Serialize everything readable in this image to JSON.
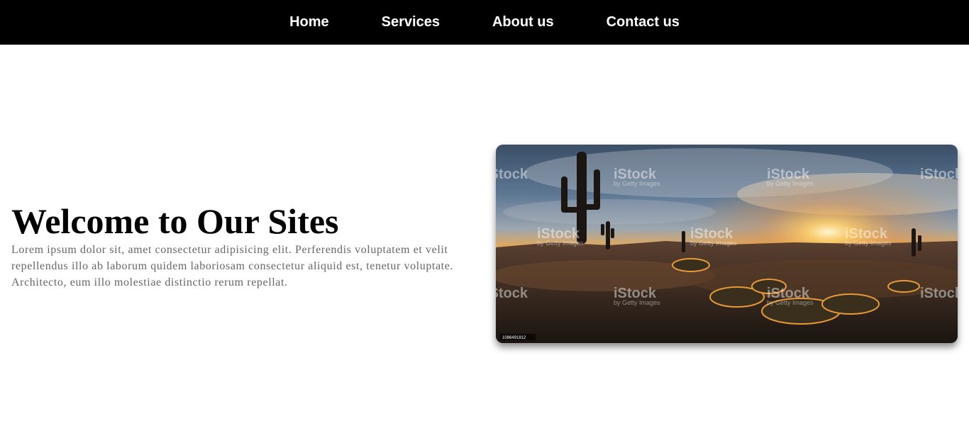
{
  "nav": {
    "items": [
      {
        "label": "Home"
      },
      {
        "label": "Services"
      },
      {
        "label": "About us"
      },
      {
        "label": "Contact us"
      }
    ]
  },
  "hero": {
    "title": "Welcome to Our Sites",
    "description": "Lorem ipsum dolor sit, amet consectetur adipisicing elit. Perferendis voluptatem et velit repellendus illo ab laborum quidem laboriosam consectetur aliquid est, tenetur voluptate. Architecto, eum illo molestiae distinctio rerum repellat."
  },
  "image": {
    "watermark": "iStock",
    "watermark_sub": "by Getty Images",
    "stock_id": "1086491812"
  },
  "colors": {
    "nav_bg": "#000000",
    "nav_text": "#ffffff",
    "title": "#000000",
    "description": "#666666"
  }
}
